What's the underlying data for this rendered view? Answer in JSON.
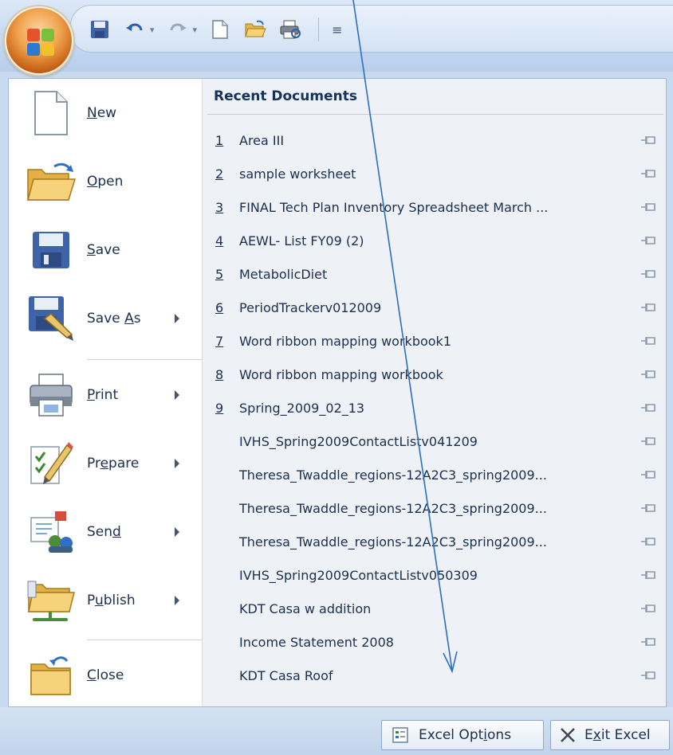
{
  "qat": {
    "buttons": [
      "save-icon",
      "undo-icon",
      "redo-icon",
      "new-icon",
      "open-icon",
      "print-preview-icon"
    ],
    "customize_glyph": "≡"
  },
  "commands": [
    {
      "id": "new",
      "pre": "",
      "ul": "N",
      "post": "ew",
      "submenu": false,
      "icon": "new-document-icon"
    },
    {
      "id": "open",
      "pre": "",
      "ul": "O",
      "post": "pen",
      "submenu": false,
      "icon": "open-folder-icon"
    },
    {
      "id": "save",
      "pre": "",
      "ul": "S",
      "post": "ave",
      "submenu": false,
      "icon": "save-icon"
    },
    {
      "id": "save-as",
      "pre": "Save ",
      "ul": "A",
      "post": "s",
      "submenu": true,
      "icon": "save-as-icon"
    },
    {
      "id": "print",
      "pre": "",
      "ul": "P",
      "post": "rint",
      "submenu": true,
      "icon": "print-icon"
    },
    {
      "id": "prepare",
      "pre": "Pr",
      "ul": "e",
      "post": "pare",
      "submenu": true,
      "icon": "prepare-icon"
    },
    {
      "id": "send",
      "pre": "Sen",
      "ul": "d",
      "post": "",
      "submenu": true,
      "icon": "send-icon"
    },
    {
      "id": "publish",
      "pre": "P",
      "ul": "u",
      "post": "blish",
      "submenu": true,
      "icon": "publish-icon"
    },
    {
      "id": "close",
      "pre": "",
      "ul": "C",
      "post": "lose",
      "submenu": false,
      "icon": "close-folder-icon"
    }
  ],
  "recent": {
    "header": "Recent Documents",
    "items": [
      {
        "num": "1",
        "name": "Area III"
      },
      {
        "num": "2",
        "name": "sample worksheet"
      },
      {
        "num": "3",
        "name": "FINAL Tech Plan Inventory Spreadsheet March ..."
      },
      {
        "num": "4",
        "name": "AEWL- List FY09 (2)"
      },
      {
        "num": "5",
        "name": "MetabolicDiet"
      },
      {
        "num": "6",
        "name": "PeriodTrackerv012009"
      },
      {
        "num": "7",
        "name": "Word ribbon mapping workbook1"
      },
      {
        "num": "8",
        "name": "Word ribbon mapping workbook"
      },
      {
        "num": "9",
        "name": "Spring_2009_02_13"
      },
      {
        "num": "",
        "name": "IVHS_Spring2009ContactListv041209"
      },
      {
        "num": "",
        "name": "Theresa_Twaddle_regions-12A2C3_spring2009..."
      },
      {
        "num": "",
        "name": "Theresa_Twaddle_regions-12A2C3_spring2009..."
      },
      {
        "num": "",
        "name": "Theresa_Twaddle_regions-12A2C3_spring2009..."
      },
      {
        "num": "",
        "name": "IVHS_Spring2009ContactListv050309"
      },
      {
        "num": "",
        "name": "KDT Casa w addition"
      },
      {
        "num": "",
        "name": "Income Statement 2008"
      },
      {
        "num": "",
        "name": "KDT Casa Roof"
      }
    ]
  },
  "bottom": {
    "options": {
      "pre": "Excel Opt",
      "ul": "i",
      "post": "ons"
    },
    "exit": {
      "pre": "E",
      "ul": "x",
      "post": "it Excel"
    }
  }
}
